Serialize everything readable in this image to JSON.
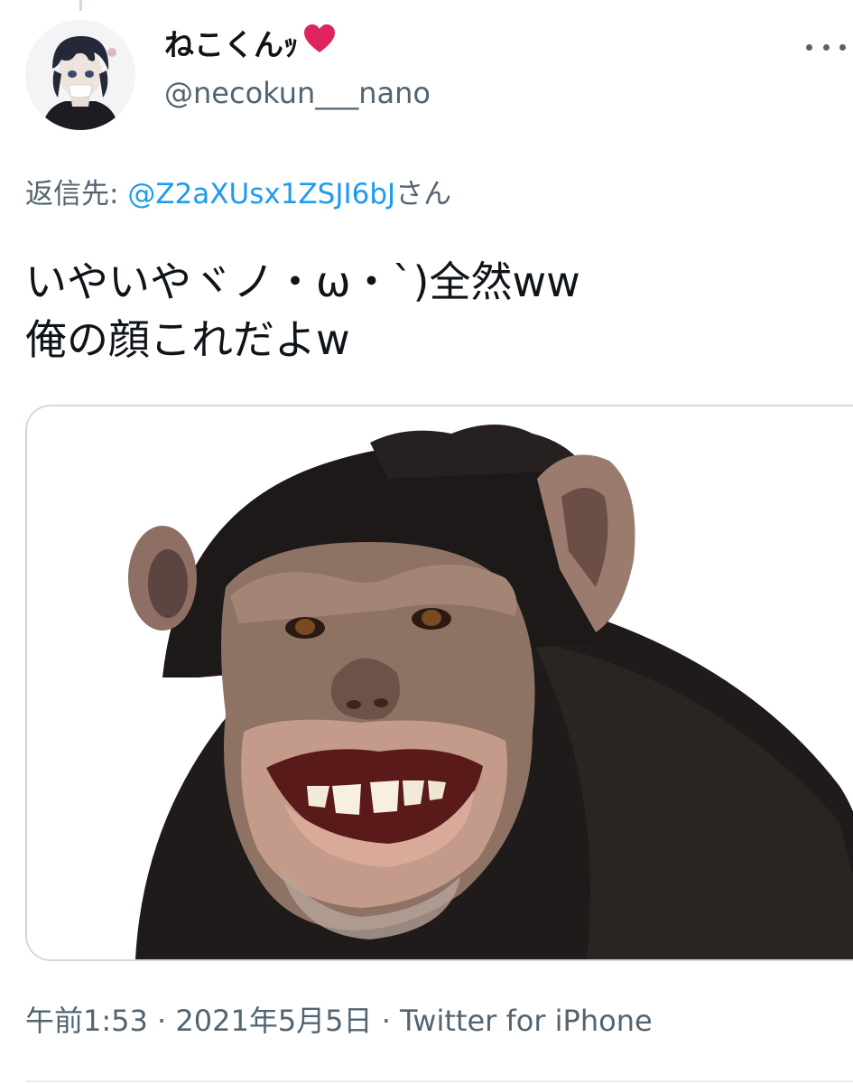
{
  "user": {
    "display_name": "ねこくんｯ",
    "heart_icon": "red-heart-icon",
    "handle": "@necokun___nano"
  },
  "reply": {
    "prefix": "返信先: ",
    "mention": "@Z2aXUsx1ZSJI6bJ",
    "suffix": "さん"
  },
  "tweet": {
    "lines": [
      "いやいやヾノ・ω・`)全然ww",
      "俺の顔これだよw"
    ]
  },
  "media": {
    "description_icon": "chimpanzee-photo"
  },
  "meta": {
    "text": "午前1:53 · 2021年5月5日 · Twitter for iPhone"
  },
  "colors": {
    "accent": "#1d9bf0",
    "secondary_text": "#536471",
    "heart": "#e0245e"
  }
}
